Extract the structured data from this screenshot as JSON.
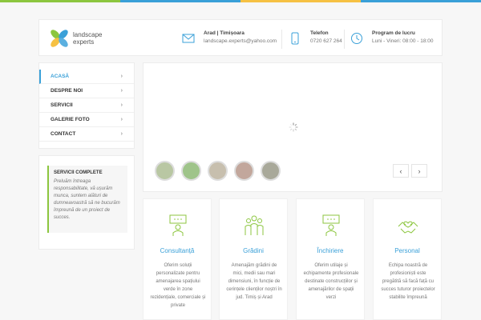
{
  "colors": {
    "accent": "#3aa0d8",
    "green": "#8cc63f",
    "yellow": "#f6c143",
    "gray_text": "#777777"
  },
  "header": {
    "logo_line1": "landscape",
    "logo_line2": "experts",
    "address_title": "Arad | Timișoara",
    "address_value": "landscape.experts@yahoo.com",
    "phone_title": "Telefon",
    "phone_value": "0720 627 264",
    "hours_title": "Program de lucru",
    "hours_value": "Luni - Vineri: 08:00 - 18:00",
    "icons": [
      "envelope-icon",
      "phone-icon",
      "clock-icon"
    ]
  },
  "sidebar": {
    "items": [
      {
        "label": "ACASĂ",
        "active": true
      },
      {
        "label": "DESPRE NOI"
      },
      {
        "label": "SERVICII"
      },
      {
        "label": "GALERIE FOTO"
      },
      {
        "label": "CONTACT"
      }
    ]
  },
  "sidebox": {
    "title": "SERVICII COMPLETE",
    "text": "Preluăm întreaga responsabilitate, vă ușurăm munca, suntem alături de dumneavoastră să ne bucurăm împreună de un proiect de succes."
  },
  "slider": {
    "thumb_colors": [
      "#b9c7a3",
      "#9fc48a",
      "#c7bfae",
      "#c2a79c",
      "#a9a99a"
    ],
    "prev_label": "‹",
    "next_label": "›"
  },
  "services": [
    {
      "title": "Consultanță",
      "desc": "Oferim soluții personalizate pentru amenajarea spațiului verde în zone rezidențiale, comerciale și private"
    },
    {
      "title": "Grădini",
      "desc": "Amenajăm grădini de mici, medii sau mari dimensiuni, în funcție de cerințele clienților noștri în jud. Timiș și Arad"
    },
    {
      "title": "Închiriere",
      "desc": "Oferim utilaje și echipamente profesionale destinate construcțiilor și amenajărilor de spații verzi"
    },
    {
      "title": "Personal",
      "desc": "Echipa noastră de profesioniști este pregătită să facă față cu succes tuturor proiectelor stabilite împreună"
    }
  ]
}
